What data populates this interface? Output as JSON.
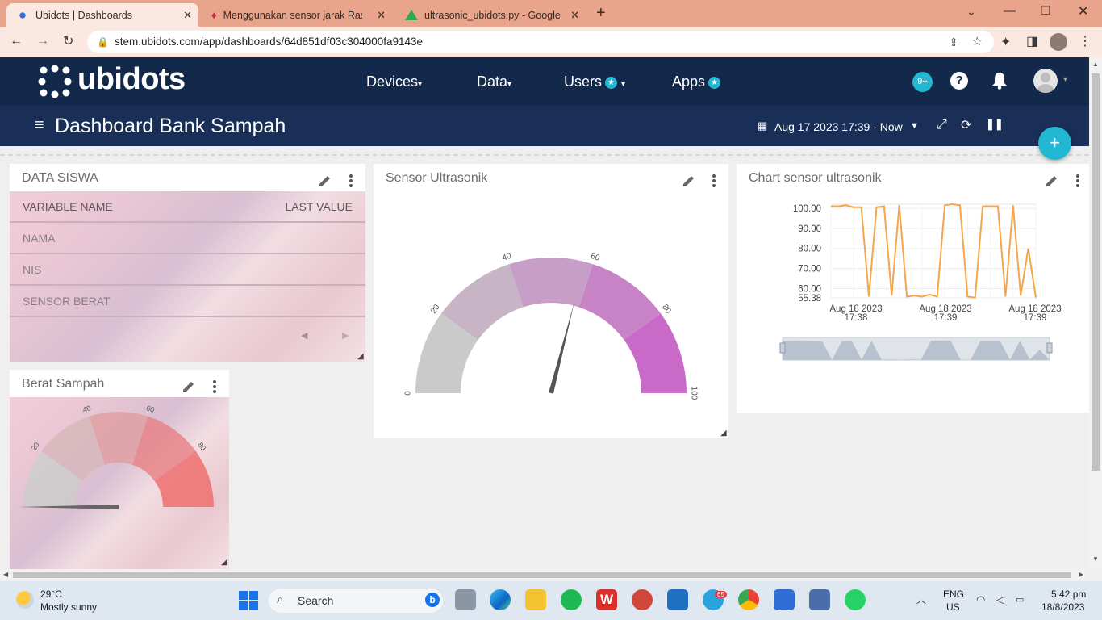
{
  "browser": {
    "tabs": [
      {
        "title": "Ubidots | Dashboards",
        "active": true
      },
      {
        "title": "Menggunakan sensor jarak Raspb",
        "active": false
      },
      {
        "title": "ultrasonic_ubidots.py - Google D",
        "active": false
      }
    ],
    "url": "stem.ubidots.com/app/dashboards/64d851df03c304000fa9143e"
  },
  "app": {
    "logo": "ubidots",
    "nav": [
      {
        "label": "Devices"
      },
      {
        "label": "Data"
      },
      {
        "label": "Users"
      },
      {
        "label": "Apps"
      }
    ],
    "notifications_badge": "9+",
    "dashboard_title": "Dashboard Bank Sampah",
    "date_range": "Aug 17 2023 17:39 - Now",
    "add_label": "+"
  },
  "widgets": {
    "data_siswa": {
      "title": "DATA SISWA",
      "col_name": "VARIABLE NAME",
      "col_value": "LAST VALUE",
      "rows": [
        "NAMA",
        "NIS",
        "SENSOR BERAT"
      ]
    },
    "sensor_ultrasonik": {
      "title": "Sensor Ultrasonik",
      "ticks": [
        "0",
        "20",
        "40",
        "60",
        "80",
        "100"
      ],
      "gauge_value": 58
    },
    "chart": {
      "title": "Chart sensor ultrasonik"
    },
    "berat_sampah": {
      "title": "Berat Sampah",
      "ticks": [
        "20",
        "40",
        "60",
        "80"
      ],
      "gauge_value": 0
    }
  },
  "chart_data": {
    "type": "line",
    "title": "Chart sensor ultrasonik",
    "ylim": [
      55.38,
      102
    ],
    "y_ticks": [
      "100.00",
      "90.00",
      "80.00",
      "70.00",
      "60.00",
      "55.38"
    ],
    "x_ticks": [
      [
        "Aug 18 2023",
        "17:38"
      ],
      [
        "Aug 18 2023",
        "17:39"
      ],
      [
        "Aug 18 2023",
        "17:39"
      ]
    ],
    "series": [
      {
        "color": "#f5a54a",
        "values": [
          101,
          101,
          101.5,
          100.5,
          100.5,
          56,
          100.5,
          101,
          56.5,
          101.5,
          56,
          56.5,
          56,
          57,
          56,
          101.5,
          102,
          101.5,
          56,
          55.5,
          101,
          101,
          101,
          56,
          101.5,
          56.5,
          80,
          55.5
        ]
      }
    ],
    "grid": true
  },
  "taskbar": {
    "weather_temp": "29°C",
    "weather_desc": "Mostly sunny",
    "search_label": "Search",
    "lang": "ENG",
    "region": "US",
    "time": "5:42 pm",
    "date": "18/8/2023",
    "telegram_badge": "65"
  }
}
